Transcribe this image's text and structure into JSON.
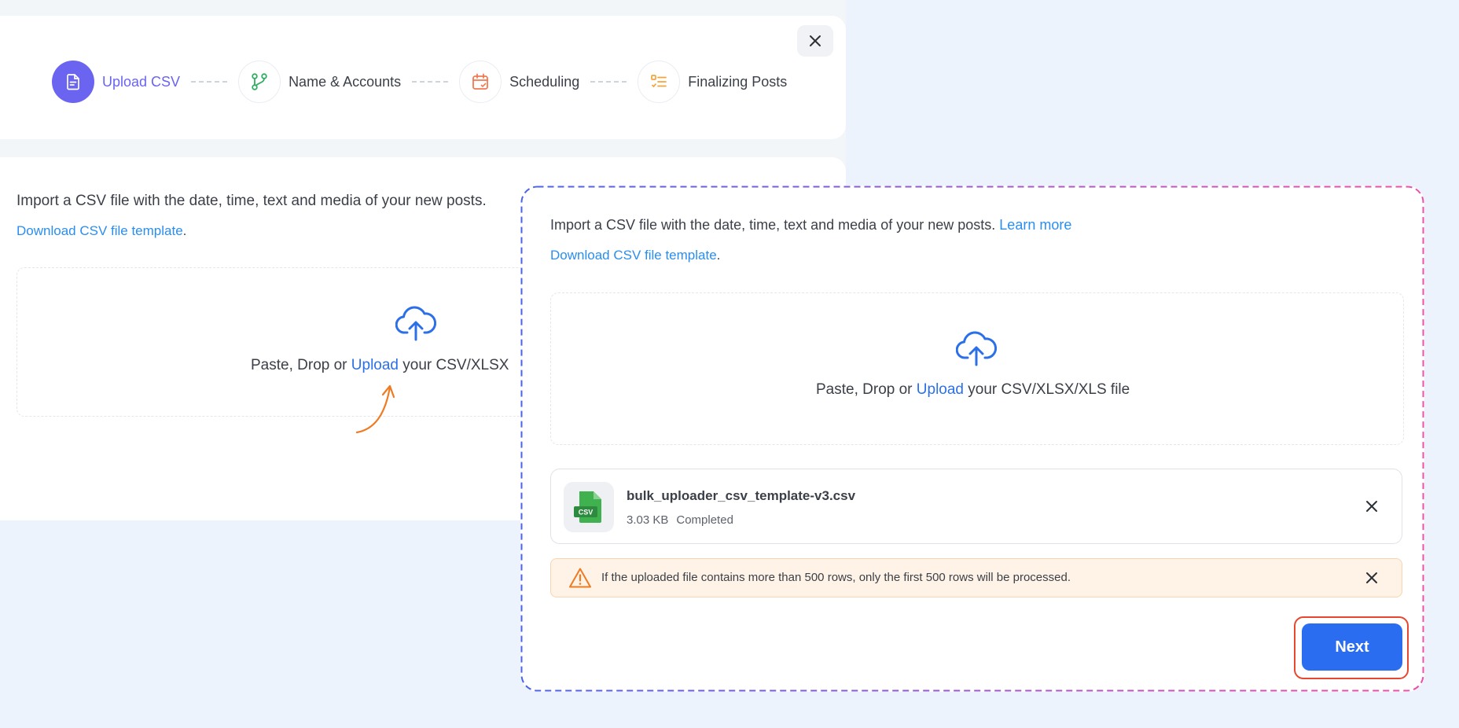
{
  "stepper": {
    "steps": [
      {
        "label": "Upload CSV",
        "icon": "document-icon",
        "active": true
      },
      {
        "label": "Name & Accounts",
        "icon": "branch-icon",
        "active": false
      },
      {
        "label": "Scheduling",
        "icon": "calendar-icon",
        "active": false
      },
      {
        "label": "Finalizing Posts",
        "icon": "checklist-icon",
        "active": false
      }
    ]
  },
  "import": {
    "intro_text": "Import a CSV file with the date, time, text and media of your new posts.",
    "learn_more": "Learn more",
    "template_link": "Download CSV file template",
    "template_suffix": "."
  },
  "dropzone": {
    "prefix": "Paste, Drop or",
    "upload_link": "Upload",
    "suffix": "your CSV/XLSX/XLS file",
    "suffix_bg_visible": "your CSV/XLSX"
  },
  "file": {
    "name": "bulk_uploader_csv_template-v3.csv",
    "size": "3.03 KB",
    "status": "Completed",
    "badge": "CSV"
  },
  "warning": {
    "text": "If the uploaded file contains more than 500 rows, only the first 500 rows will be processed."
  },
  "actions": {
    "next_label": "Next"
  },
  "colors": {
    "accent": "#6a64f1",
    "link": "#2a8ef0",
    "primary_button": "#2b6df0",
    "highlight_gradient_start": "#4a63ee",
    "highlight_gradient_end": "#ee4fa8",
    "next_outline": "#e8472f",
    "arrow": "#f07a22"
  }
}
